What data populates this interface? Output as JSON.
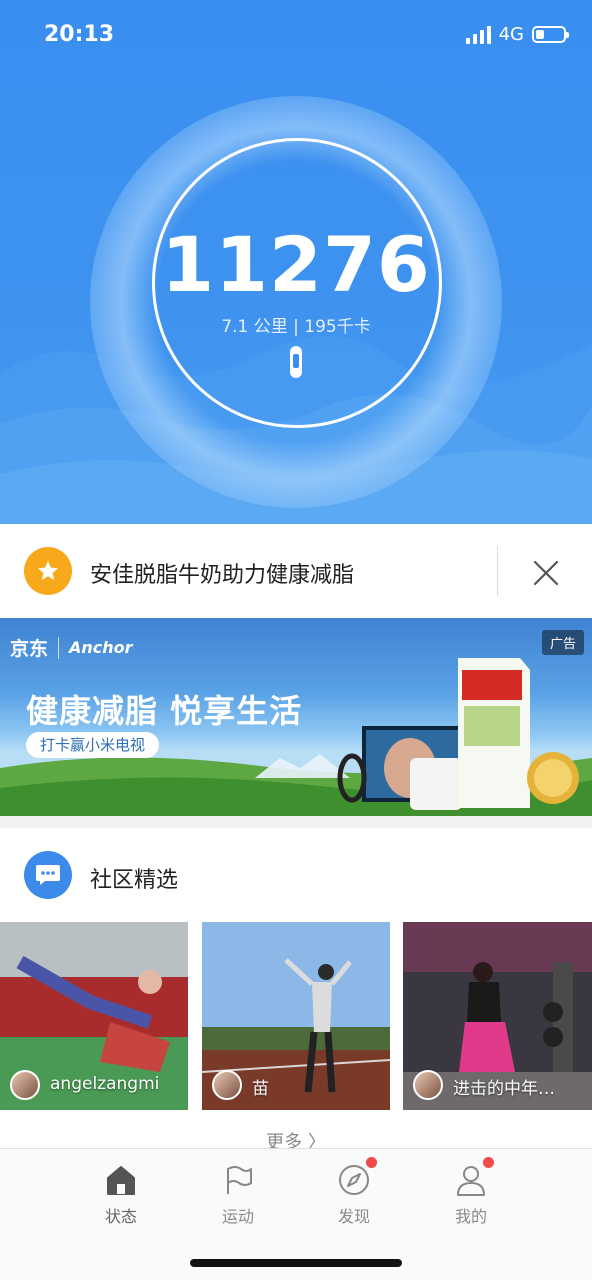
{
  "status_bar": {
    "time": "20:13",
    "network": "4G"
  },
  "hero": {
    "steps": "11276",
    "summary": "7.1 公里 | 195千卡",
    "device_icon": "band-icon"
  },
  "promo": {
    "text": "安佳脱脂牛奶助力健康减脂",
    "icon": "star-icon",
    "close_icon": "close-icon"
  },
  "ad": {
    "brand_jd": "京东",
    "brand_anchor": "Anchor",
    "title": "健康减脂 悦享生活",
    "cta": "打卡赢小米电视",
    "badge": "广告"
  },
  "community": {
    "title": "社区精选",
    "icon": "chat-icon",
    "posts": [
      {
        "user": "angelzangmi"
      },
      {
        "user": "苗"
      },
      {
        "user": "进击的中年…"
      }
    ],
    "more": "更多 〉"
  },
  "tabs": [
    {
      "label": "状态",
      "icon": "home-icon",
      "active": true,
      "badge": false
    },
    {
      "label": "运动",
      "icon": "flag-icon",
      "active": false,
      "badge": false
    },
    {
      "label": "发现",
      "icon": "compass-icon",
      "active": false,
      "badge": true
    },
    {
      "label": "我的",
      "icon": "profile-icon",
      "active": false,
      "badge": true
    }
  ],
  "colors": {
    "hero_blue": "#3a8ef0",
    "accent_orange": "#f7a81b",
    "badge_red": "#f04a4a"
  }
}
